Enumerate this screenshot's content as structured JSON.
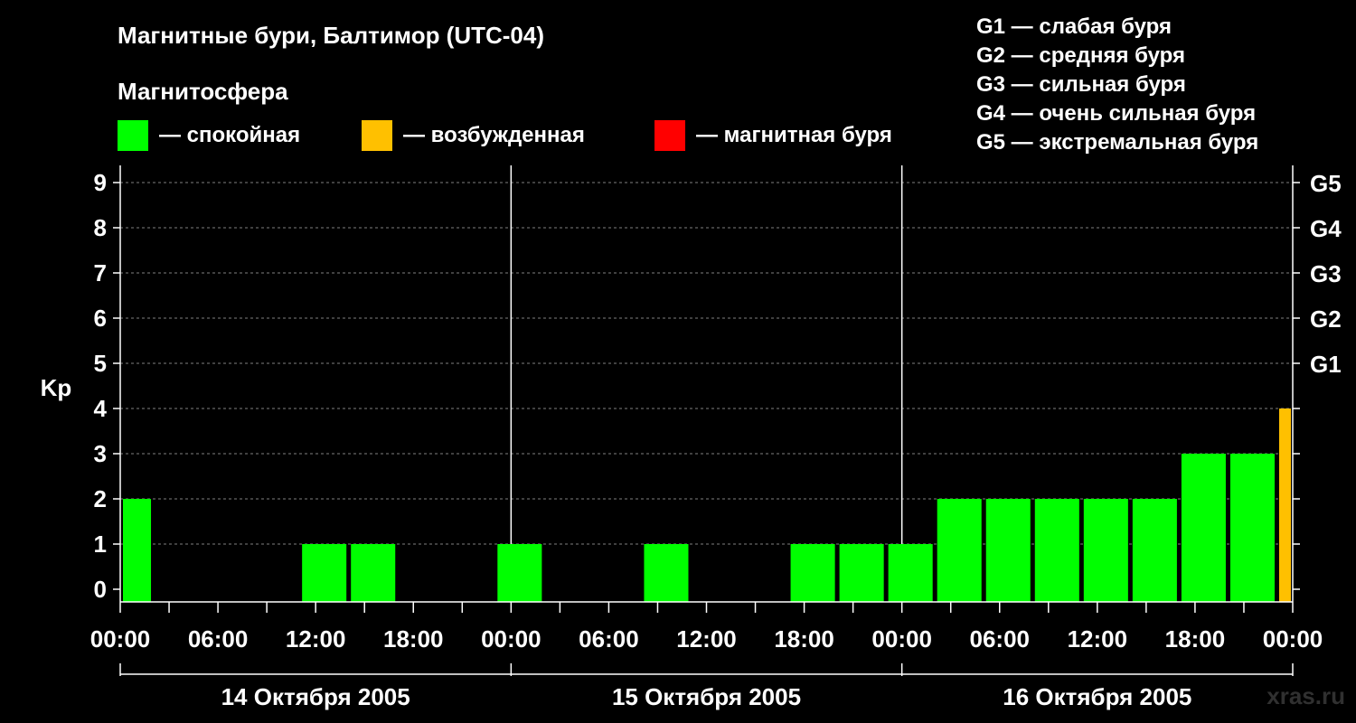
{
  "title": "Магнитные бури, Балтимор (UTC-04)",
  "subtitle": "Магнитосфера",
  "legend": [
    {
      "color": "#00ff00",
      "label": "— спокойная"
    },
    {
      "color": "#ffc000",
      "label": "— возбужденная"
    },
    {
      "color": "#ff0000",
      "label": "— магнитная буря"
    }
  ],
  "g_legend": [
    "G1 — слабая буря",
    "G2 — средняя буря",
    "G3 — сильная буря",
    "G4 — очень сильная буря",
    "G5 — экстремальная буря"
  ],
  "watermark": "xras.ru",
  "chart_data": {
    "type": "bar",
    "ylabel": "Kp",
    "ylim": [
      0,
      9
    ],
    "yticks": [
      0,
      1,
      2,
      3,
      4,
      5,
      6,
      7,
      8,
      9
    ],
    "right_ticks": [
      {
        "value": 5,
        "label": "G1"
      },
      {
        "value": 6,
        "label": "G2"
      },
      {
        "value": 7,
        "label": "G3"
      },
      {
        "value": 8,
        "label": "G4"
      },
      {
        "value": 9,
        "label": "G5"
      }
    ],
    "x_range_hours": [
      0,
      72
    ],
    "x_tick_labels": [
      "00:00",
      "06:00",
      "12:00",
      "18:00",
      "00:00",
      "06:00",
      "12:00",
      "18:00",
      "00:00",
      "06:00",
      "12:00",
      "18:00",
      "00:00"
    ],
    "days": [
      "14 Октября 2005",
      "15 Октября 2005",
      "16 Октября 2005"
    ],
    "grid": true,
    "colors": {
      "quiet": "#00ff00",
      "active": "#ffc000",
      "storm": "#ff0000"
    },
    "bars": [
      {
        "start_h": 0,
        "end_h": 2,
        "kp": 2,
        "level": "quiet"
      },
      {
        "start_h": 11,
        "end_h": 14,
        "kp": 1,
        "level": "quiet"
      },
      {
        "start_h": 14,
        "end_h": 17,
        "kp": 1,
        "level": "quiet"
      },
      {
        "start_h": 23,
        "end_h": 26,
        "kp": 1,
        "level": "quiet"
      },
      {
        "start_h": 32,
        "end_h": 35,
        "kp": 1,
        "level": "quiet"
      },
      {
        "start_h": 41,
        "end_h": 44,
        "kp": 1,
        "level": "quiet"
      },
      {
        "start_h": 44,
        "end_h": 47,
        "kp": 1,
        "level": "quiet"
      },
      {
        "start_h": 47,
        "end_h": 50,
        "kp": 1,
        "level": "quiet"
      },
      {
        "start_h": 50,
        "end_h": 53,
        "kp": 2,
        "level": "quiet"
      },
      {
        "start_h": 53,
        "end_h": 56,
        "kp": 2,
        "level": "quiet"
      },
      {
        "start_h": 56,
        "end_h": 59,
        "kp": 2,
        "level": "quiet"
      },
      {
        "start_h": 59,
        "end_h": 62,
        "kp": 2,
        "level": "quiet"
      },
      {
        "start_h": 62,
        "end_h": 65,
        "kp": 2,
        "level": "quiet"
      },
      {
        "start_h": 65,
        "end_h": 68,
        "kp": 3,
        "level": "quiet"
      },
      {
        "start_h": 68,
        "end_h": 71,
        "kp": 3,
        "level": "quiet"
      },
      {
        "start_h": 71,
        "end_h": 72,
        "kp": 4,
        "level": "active"
      }
    ]
  }
}
